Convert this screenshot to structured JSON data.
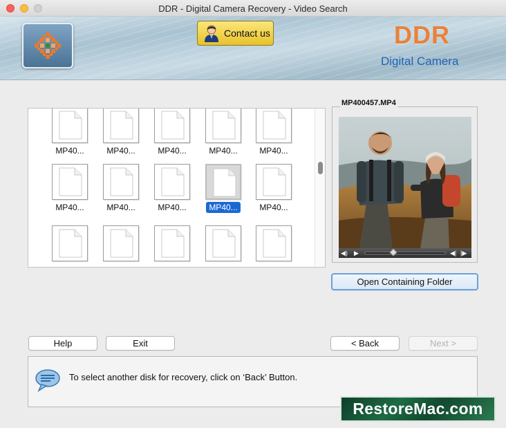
{
  "window": {
    "title": "DDR - Digital Camera Recovery - Video Search"
  },
  "header": {
    "contact_label": "Contact us",
    "brand_title": "DDR",
    "brand_subtitle": "Digital Camera"
  },
  "grid": {
    "rows": [
      {
        "tiles": [
          {
            "label": "MP40...",
            "selected": false
          },
          {
            "label": "MP40...",
            "selected": false
          },
          {
            "label": "MP40...",
            "selected": false
          },
          {
            "label": "MP40...",
            "selected": false
          },
          {
            "label": "MP40...",
            "selected": false
          }
        ]
      },
      {
        "tiles": [
          {
            "label": "MP40...",
            "selected": false
          },
          {
            "label": "MP40...",
            "selected": false
          },
          {
            "label": "MP40...",
            "selected": false
          },
          {
            "label": "MP40...",
            "selected": true
          },
          {
            "label": "MP40...",
            "selected": false
          }
        ]
      },
      {
        "tiles": [
          {
            "label": "",
            "selected": false
          },
          {
            "label": "",
            "selected": false
          },
          {
            "label": "",
            "selected": false
          },
          {
            "label": "",
            "selected": false
          },
          {
            "label": "",
            "selected": false
          }
        ]
      }
    ]
  },
  "preview": {
    "filename": "MP400457.MP4",
    "open_folder_label": "Open Containing Folder",
    "playback_position": 0.35
  },
  "buttons": {
    "help": "Help",
    "exit": "Exit",
    "back": "< Back",
    "next": "Next >"
  },
  "message": {
    "text": "To select another disk for recovery, click on ‘Back’ Button."
  },
  "watermark": {
    "text": "RestoreMac.com"
  },
  "colors": {
    "brand_orange": "#e9823a",
    "brand_blue": "#1f63b8",
    "selection_blue": "#1a69d3"
  }
}
